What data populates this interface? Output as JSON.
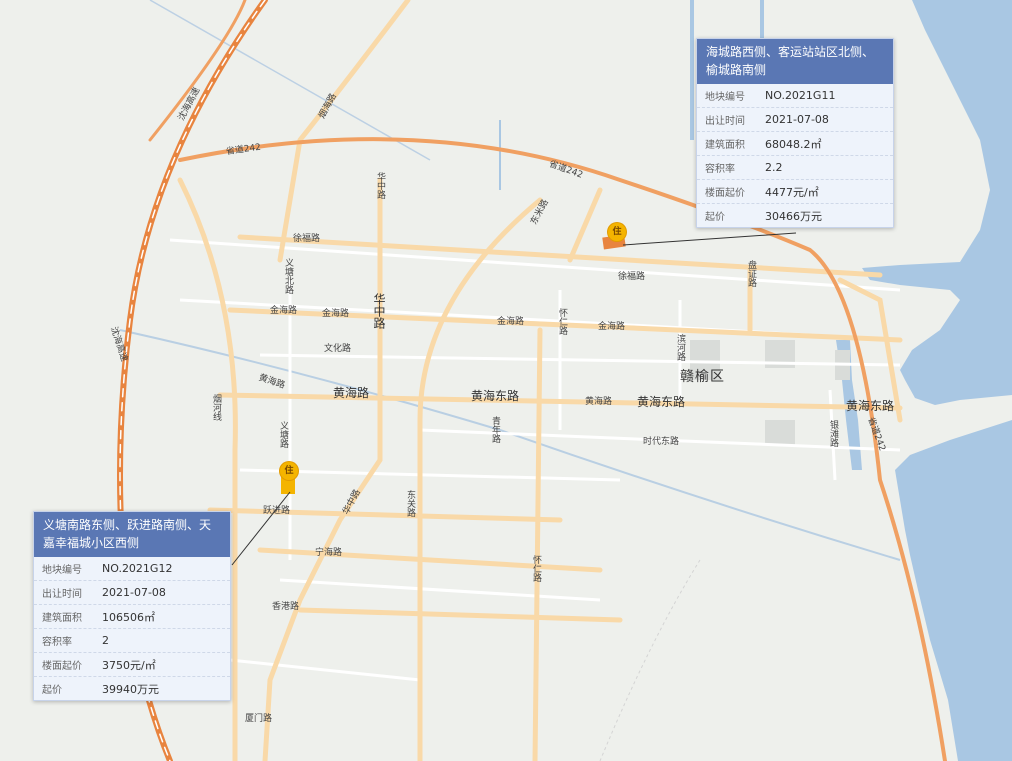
{
  "map": {
    "district": "赣榆区",
    "road_labels": {
      "shenhai": "沈海高速",
      "shengdao242": "省道242",
      "yanhai": "烟海路",
      "huazhong": "华中路",
      "dongmi": "东米路",
      "xufu": "徐福路",
      "yitang_north": "义塘北路",
      "panzheng": "盘证路",
      "jinhai": "金海路",
      "wenhua": "文化路",
      "huaiyuan": "怀仁路",
      "binhe": "滨河路",
      "huanghai": "黄海路",
      "huanghai_east": "黄海东路",
      "yanghe": "烟河线",
      "yitang": "义塘路",
      "qingnian": "青年路",
      "shidai": "时代东路",
      "yuejin": "跃进路",
      "dongguan": "东关路",
      "ningbo": "宁海路",
      "xianggang": "香港路",
      "xiamen": "厦门路",
      "yinhai": "银滩路"
    },
    "markers": [
      {
        "glyph": "住"
      },
      {
        "glyph": "住"
      }
    ],
    "colors": {
      "land": "#eef0ec",
      "water": "#a9c7e3",
      "expressway": "#e8843f",
      "major_road": "#f9d9a8",
      "minor_road": "#ffffff",
      "parcel": "#e8843f",
      "pin": "#f4b400",
      "card_header": "#5a77b4"
    }
  },
  "cards": [
    {
      "title": "海城路西侧、客运站站区北侧、榆城路南侧",
      "rows": [
        {
          "key": "地块编号",
          "value": "NO.2021G11"
        },
        {
          "key": "出让时间",
          "value": "2021-07-08"
        },
        {
          "key": "建筑面积",
          "value": "68048.2㎡"
        },
        {
          "key": "容积率",
          "value": "2.2"
        },
        {
          "key": "楼面起价",
          "value": "4477元/㎡"
        },
        {
          "key": "起价",
          "value": "30466万元"
        }
      ]
    },
    {
      "title": "义塘南路东侧、跃进路南侧、天嘉幸福城小区西侧",
      "rows": [
        {
          "key": "地块编号",
          "value": "NO.2021G12"
        },
        {
          "key": "出让时间",
          "value": "2021-07-08"
        },
        {
          "key": "建筑面积",
          "value": "106506㎡"
        },
        {
          "key": "容积率",
          "value": "2"
        },
        {
          "key": "楼面起价",
          "value": "3750元/㎡"
        },
        {
          "key": "起价",
          "value": "39940万元"
        }
      ]
    }
  ]
}
